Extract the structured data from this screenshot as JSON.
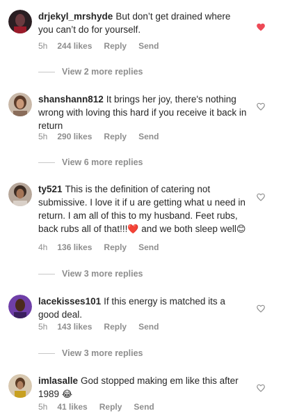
{
  "comments": [
    {
      "username": "drjekyl_mrshyde",
      "text": "But don’t get drained where you can’t do for yourself.",
      "time": "5h",
      "likes": "244 likes",
      "reply": "Reply",
      "send": "Send",
      "liked": true,
      "view_replies": "View 2 more replies"
    },
    {
      "username": "shanshann812",
      "text": "It brings her joy, there's nothing wrong with loving this hard if you receive it back in return",
      "time": "5h",
      "likes": "290 likes",
      "reply": "Reply",
      "send": "Send",
      "liked": false,
      "view_replies": "View 6 more replies"
    },
    {
      "username": "ty521",
      "text_before": "This is the definition of catering not submissive. I love it if u are getting what u need in return. I am all of this to my husband. Feet rubs, back rubs all of that!!!",
      "emoji1": "❤️",
      "text_middle": " and we both sleep well",
      "emoji2": "😊",
      "time": "4h",
      "likes": "136 likes",
      "reply": "Reply",
      "send": "Send",
      "liked": false,
      "view_replies": "View 3 more replies"
    },
    {
      "username": "lacekisses101",
      "text": "If this energy is matched its a good deal.",
      "time": "5h",
      "likes": "143 likes",
      "reply": "Reply",
      "send": "Send",
      "liked": false,
      "view_replies": "View 3 more replies"
    },
    {
      "username": "imlasalle",
      "text": "God stopped making em like this after 1989",
      "emoji": "😂",
      "time": "5h",
      "likes": "41 likes",
      "reply": "Reply",
      "send": "Send",
      "liked": false
    }
  ],
  "colors": {
    "heart_liked": "#ed4956",
    "heart_outline": "#8e8e8e",
    "meta": "#8e8e8e"
  }
}
